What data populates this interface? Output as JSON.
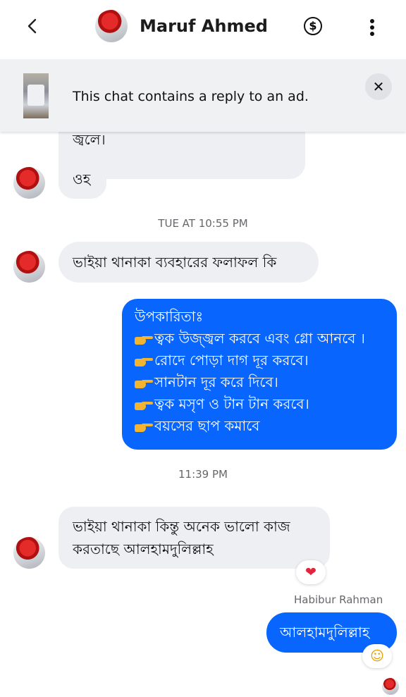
{
  "header": {
    "back_icon": "chevron-left-icon",
    "contact_name": "Maruf Ahmed",
    "dollar_icon": "dollar-circle-icon",
    "more_icon": "vertical-dots-icon"
  },
  "banner": {
    "text": "This chat contains a reply to an ad.",
    "close_label": "✕"
  },
  "messages": {
    "m1_partial": "জ্বলে।",
    "m2": "ওহ",
    "ts1": "TUE AT 10:55 PM",
    "m3": "ভাইয়া থানাকা ব্যবহারের ফলাফল কি",
    "m4": {
      "title": "উপকারিতাঃ",
      "items": [
        "ত্বক উজ্জ্বল করবে এবং গ্লো আনবে ।",
        "রোদে পোড়া দাগ দূর করবে।",
        "সানটান দূর করে দিবে।",
        "ত্বক মসৃণ ও টান টান করবে।",
        "বয়সের ছাপ কমাবে"
      ]
    },
    "ts2": "11:39 PM",
    "m5_line1": "ভাইয়া থানাকা কিন্তু অনেক ভালো কাজ",
    "m5_line2": "করতাছে আলহামদুলিল্লাহ",
    "m5_reaction": "❤",
    "sender_name": "Habibur Rahman",
    "m6": "আলহামদুলিল্লাহ",
    "m6_reaction": "☺"
  },
  "colors": {
    "outgoing_bubble": "#0866ff",
    "incoming_bubble": "#eeeff2",
    "timestamp_text": "#65676b"
  }
}
